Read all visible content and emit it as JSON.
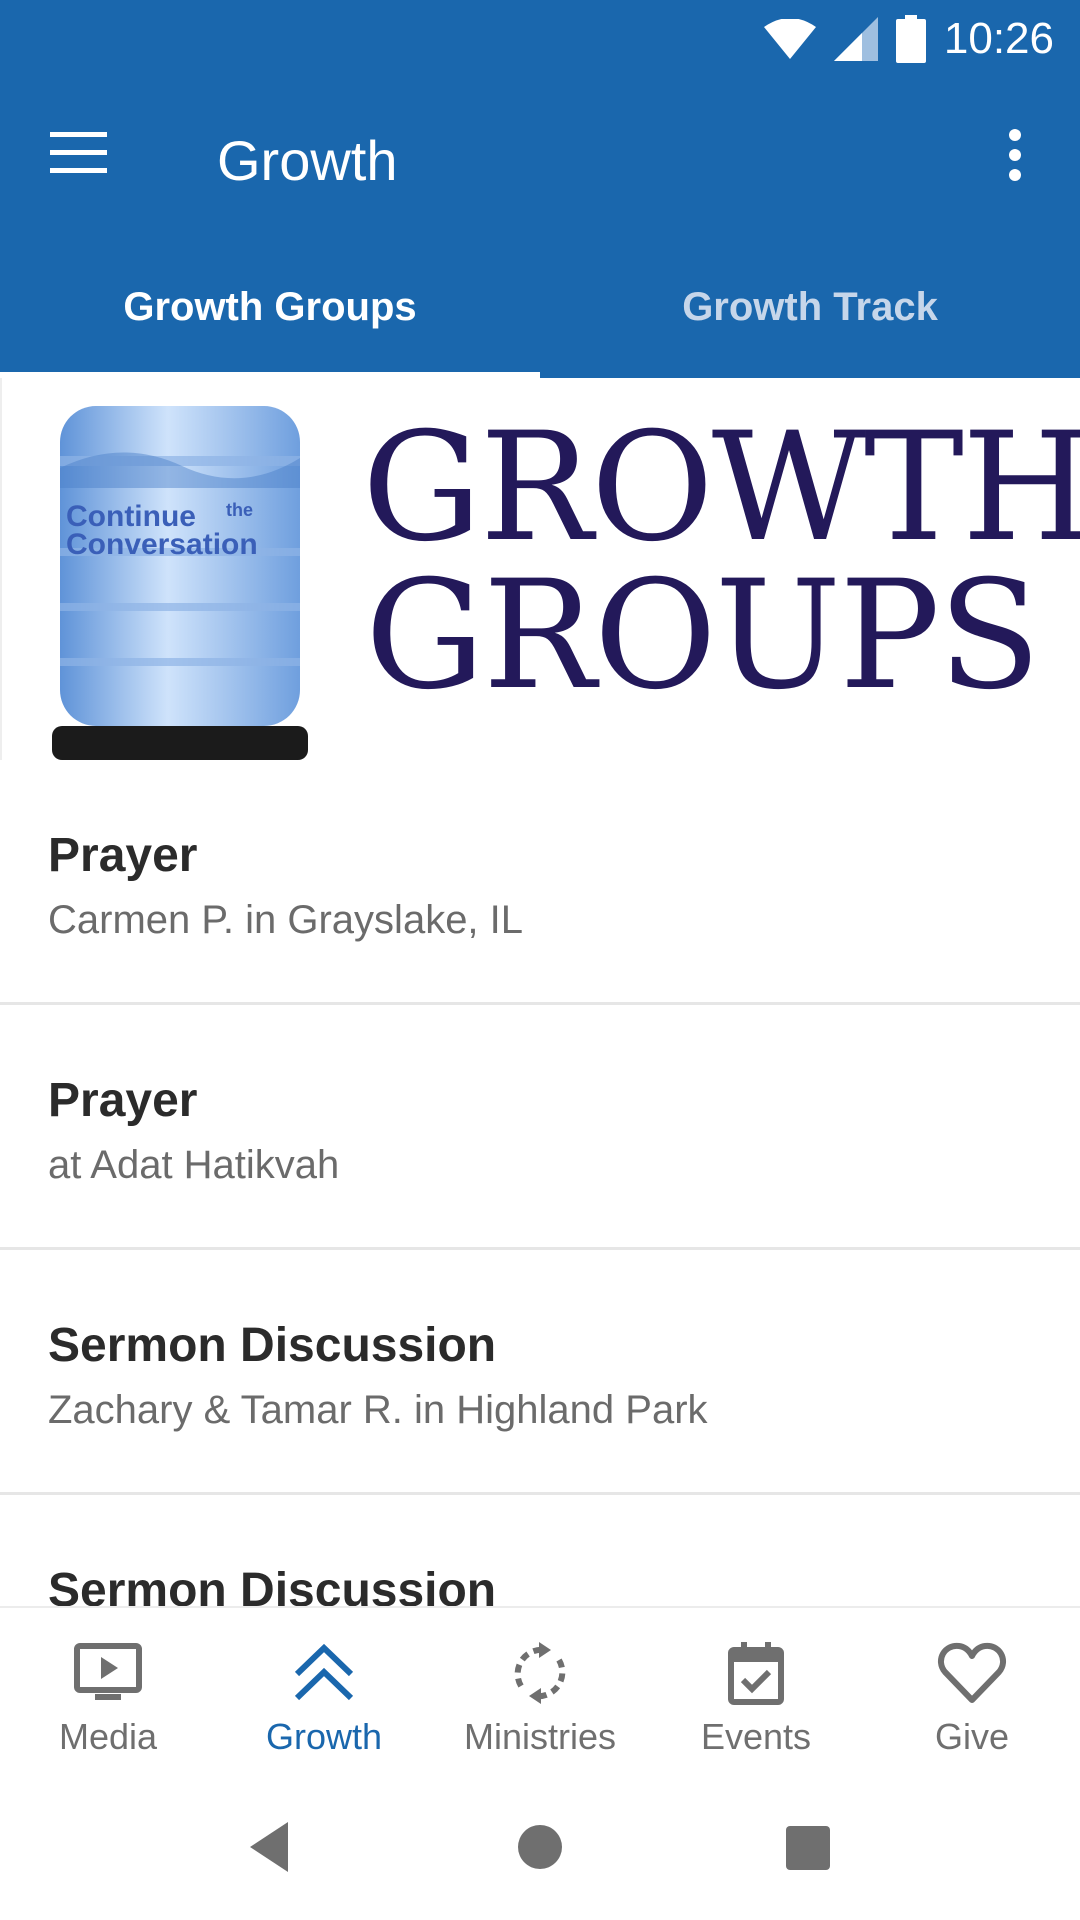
{
  "status_bar": {
    "time": "10:26",
    "icons": [
      "wifi-icon",
      "cell-signal-icon",
      "battery-icon"
    ]
  },
  "app_bar": {
    "title": "Growth",
    "menu_icon": "hamburger-menu-icon",
    "overflow_icon": "more-vert-icon"
  },
  "tabs": [
    {
      "label": "Growth Groups",
      "active": true
    },
    {
      "label": "Growth Track",
      "active": false
    }
  ],
  "banner": {
    "jug_text_1": "Continue",
    "jug_text_2": "the",
    "jug_text_3": "Conversation",
    "line1": "GROWTH",
    "line2": "GROUPS"
  },
  "list": [
    {
      "title": "Prayer",
      "subtitle": "Carmen P. in Grayslake, IL"
    },
    {
      "title": "Prayer",
      "subtitle": "at Adat Hatikvah"
    },
    {
      "title": "Sermon Discussion",
      "subtitle": "Zachary & Tamar R. in Highland Park"
    },
    {
      "title": "Sermon Discussion",
      "subtitle": ""
    }
  ],
  "bottom_nav": [
    {
      "label": "Media",
      "icon": "tv-play-icon",
      "active": false
    },
    {
      "label": "Growth",
      "icon": "double-chevron-up-icon",
      "active": true
    },
    {
      "label": "Ministries",
      "icon": "refresh-icon",
      "active": false
    },
    {
      "label": "Events",
      "icon": "calendar-check-icon",
      "active": false
    },
    {
      "label": "Give",
      "icon": "heart-icon",
      "active": false
    }
  ],
  "colors": {
    "primary": "#1a67ad",
    "banner_text": "#23195a",
    "active_nav": "#1a67ad",
    "inactive_nav": "#6f6f6f"
  }
}
